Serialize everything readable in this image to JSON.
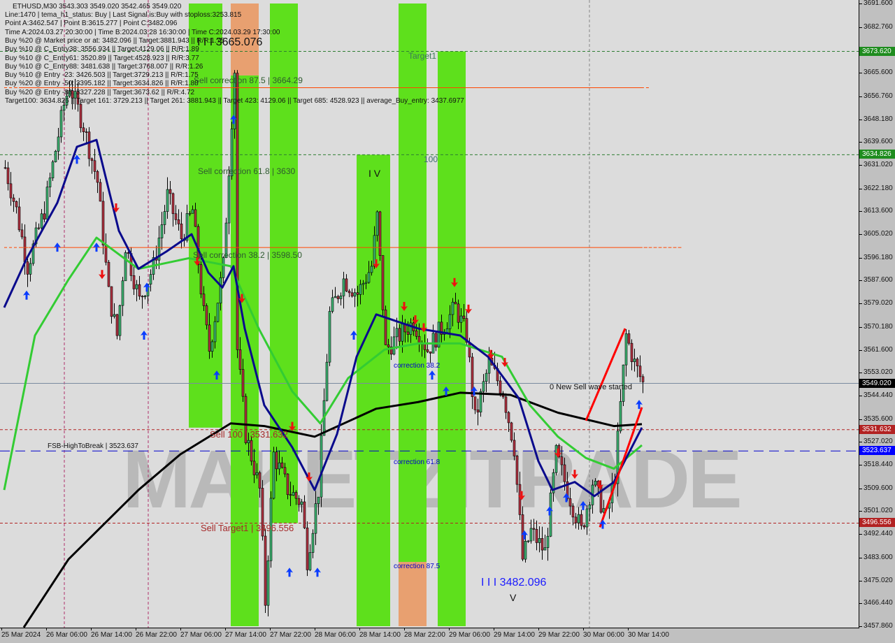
{
  "chart_data": {
    "type": "candlestick",
    "symbol_line": "ETHUSD,M30  3543.303 3549.020 3542.465 3549.020",
    "info_lines": [
      "Line:1470 | tema_h1_status: Buy | Last Signal is:Buy with stoploss:3253.815",
      "Point A:3462.547 | Point B:3615.277 | Point C:3482.096",
      "Time A:2024.03.27 20:30:00 | Time B:2024.03.28 16:30:00 | Time C:2024.03.29 17:30:00",
      "Buy %20 @ Market price or at: 3482.096 || Target:3881.943 || R/R:1.75",
      "Buy %10 @ C_Entry38: 3556.934 || Target:4129.06 || R/R:1.89",
      "Buy %10 @ C_Entry61: 3520.89 || Target:4528.923 || R/R:3.77",
      "Buy %10 @ C_Entry88: 3481.638 || Target:3768.007 || R/R:1.26",
      "Buy %10 @ Entry -23: 3426.503 || Target:3729.213 || R/R:1.75",
      "Buy %20 @ Entry -50: 3395.182 || Target:3634.826 || R/R:1.88",
      "Buy %20 @ Entry -88: 3327.228 || Target:3673.62 || R/R:4.72",
      "Target100: 3634.826 || Target 161: 3729.213 || Target 261: 3881.943 || Target 423: 4129.06 || Target 685: 4528.923 || average_Buy_entry: 3437.6977"
    ],
    "ylim": [
      3457.86,
      3691.6
    ],
    "y_ticks": [
      "3691.600",
      "3682.760",
      "3673.620",
      "3665.600",
      "3656.760",
      "3648.180",
      "3639.600",
      "3631.020",
      "3622.180",
      "3613.600",
      "3605.020",
      "3596.180",
      "3587.600",
      "3579.020",
      "3570.180",
      "3561.600",
      "3553.020",
      "3544.440",
      "3535.600",
      "3527.020",
      "3518.440",
      "3509.600",
      "3501.020",
      "3492.440",
      "3483.600",
      "3475.020",
      "3466.440",
      "3457.860"
    ],
    "x_ticks": [
      {
        "label": "25 Mar 2024",
        "t": "25 22:00"
      },
      {
        "label": "26 Mar 06:00",
        "t": "26 06:00"
      },
      {
        "label": "26 Mar 14:00",
        "t": "26 14:00"
      },
      {
        "label": "26 Mar 22:00",
        "t": "26 22:00"
      },
      {
        "label": "27 Mar 06:00",
        "t": "27 06:00"
      },
      {
        "label": "27 Mar 14:00",
        "t": "27 14:00"
      },
      {
        "label": "27 Mar 22:00",
        "t": "27 22:00"
      },
      {
        "label": "28 Mar 06:00",
        "t": "28 06:00"
      },
      {
        "label": "28 Mar 14:00",
        "t": "28 14:00"
      },
      {
        "label": "28 Mar 22:00",
        "t": "28 22:00"
      },
      {
        "label": "29 Mar 06:00",
        "t": "29 06:00"
      },
      {
        "label": "29 Mar 14:00",
        "t": "29 14:00"
      },
      {
        "label": "29 Mar 22:00",
        "t": "29 22:00"
      },
      {
        "label": "30 Mar 06:00",
        "t": "30 06:00"
      },
      {
        "label": "30 Mar 14:00",
        "t": "30 14:00"
      }
    ],
    "price_badges": [
      {
        "value": "3673.620",
        "price": 3673.62,
        "color": "#1e8c1e"
      },
      {
        "value": "3634.826",
        "price": 3634.826,
        "color": "#1e8c1e"
      },
      {
        "value": "3549.020",
        "price": 3549.02,
        "color": "#000000"
      },
      {
        "value": "3531.632",
        "price": 3531.632,
        "color": "#b22222"
      },
      {
        "value": "3523.637",
        "price": 3523.637,
        "color": "#0000ff"
      },
      {
        "value": "3496.556",
        "price": 3496.556,
        "color": "#b22222"
      }
    ],
    "hlines": [
      {
        "price": 3673.62,
        "color": "#2e7d32",
        "style": "dashed"
      },
      {
        "price": 3634.826,
        "color": "#2e7d32",
        "style": "dashed"
      },
      {
        "price": 3549.02,
        "color": "#7a8aa0",
        "style": "solid"
      },
      {
        "price": 3531.632,
        "color": "#b22222",
        "style": "dashed"
      },
      {
        "price": 3523.637,
        "color": "#0000cc",
        "style": "dashed"
      },
      {
        "price": 3496.556,
        "color": "#b22222",
        "style": "dashed"
      }
    ],
    "zones": [
      {
        "from": "27 07:30",
        "to": "27 13:30",
        "top": 3691.6,
        "bottom": 3532.4,
        "color": "#5ee01c"
      },
      {
        "from": "27 15:00",
        "to": "27 20:00",
        "top": 3664.6,
        "bottom": 3457.86,
        "color": "#5ee01c"
      },
      {
        "from": "27 15:00",
        "to": "27 20:00",
        "top": 3691.6,
        "bottom": 3664.6,
        "color": "#e8a070"
      },
      {
        "from": "27 22:00",
        "to": "28 03:00",
        "top": 3691.6,
        "bottom": 3496.556,
        "color": "#5ee01c"
      },
      {
        "from": "28 13:30",
        "to": "28 19:30",
        "top": 3634.826,
        "bottom": 3457.86,
        "color": "#5ee01c"
      },
      {
        "from": "28 21:00",
        "to": "29 02:00",
        "top": 3691.6,
        "bottom": 3482.0,
        "color": "#5ee01c"
      },
      {
        "from": "28 21:00",
        "to": "29 02:00",
        "top": 3482.0,
        "bottom": 3457.86,
        "color": "#e8a070"
      },
      {
        "from": "29 04:00",
        "to": "29 09:00",
        "top": 3673.62,
        "bottom": 3457.86,
        "color": "#5ee01c"
      }
    ],
    "price_path": [
      [
        "25 22:30",
        3630
      ],
      [
        "26 00:30",
        3614
      ],
      [
        "26 02:30",
        3593
      ],
      [
        "26 05:30",
        3614
      ],
      [
        "26 09:00",
        3653.5
      ],
      [
        "26 10:00",
        3661
      ],
      [
        "26 12:30",
        3645.7
      ],
      [
        "26 15:00",
        3624.7
      ],
      [
        "26 17:00",
        3582.7
      ],
      [
        "26 18:30",
        3567
      ],
      [
        "26 20:00",
        3601
      ],
      [
        "26 22:30",
        3580
      ],
      [
        "27 01:00",
        3593
      ],
      [
        "27 03:30",
        3619.5
      ],
      [
        "27 06:00",
        3603.7
      ],
      [
        "27 08:00",
        3614
      ],
      [
        "27 10:00",
        3574.9
      ],
      [
        "27 11:00",
        3561.7
      ],
      [
        "27 13:30",
        3593
      ],
      [
        "27 15:30",
        3666.7
      ],
      [
        "27 16:00",
        3561.7
      ],
      [
        "27 17:30",
        3530
      ],
      [
        "27 20:00",
        3509
      ],
      [
        "27 21:00",
        3467
      ],
      [
        "27 22:30",
        3522.4
      ],
      [
        "28 01:00",
        3509.3
      ],
      [
        "28 03:30",
        3504
      ],
      [
        "28 04:30",
        3483
      ],
      [
        "28 06:30",
        3509
      ],
      [
        "28 08:30",
        3575
      ],
      [
        "28 11:00",
        3588
      ],
      [
        "28 13:30",
        3582.7
      ],
      [
        "28 16:00",
        3593
      ],
      [
        "28 17:00",
        3611.6
      ],
      [
        "28 18:30",
        3561.7
      ],
      [
        "28 21:00",
        3567
      ],
      [
        "28 23:30",
        3572
      ],
      [
        "29 02:00",
        3561.7
      ],
      [
        "29 04:30",
        3569.6
      ],
      [
        "29 07:00",
        3577.5
      ],
      [
        "29 09:00",
        3567
      ],
      [
        "29 10:30",
        3535.5
      ],
      [
        "29 13:00",
        3556.5
      ],
      [
        "29 15:30",
        3546
      ],
      [
        "29 17:30",
        3525
      ],
      [
        "29 19:00",
        3483
      ],
      [
        "29 20:30",
        3493.5
      ],
      [
        "29 23:00",
        3485.7
      ],
      [
        "30 01:00",
        3522.4
      ],
      [
        "30 03:00",
        3509
      ],
      [
        "30 05:30",
        3493.5
      ],
      [
        "30 07:30",
        3512
      ],
      [
        "30 10:00",
        3498.8
      ],
      [
        "30 11:30",
        3514.6
      ],
      [
        "30 13:30",
        3567
      ],
      [
        "30 15:00",
        3556.5
      ],
      [
        "30 16:30",
        3549.02
      ]
    ],
    "series": [
      {
        "color": "#000000",
        "points": [
          [
            "26 02:00",
            3457.4
          ],
          [
            "26 10:00",
            3483
          ],
          [
            "26 22:30",
            3509
          ],
          [
            "27 06:00",
            3522.4
          ],
          [
            "27 15:00",
            3534
          ],
          [
            "27 21:00",
            3533
          ],
          [
            "28 06:00",
            3529
          ],
          [
            "28 17:00",
            3539.5
          ],
          [
            "29 00:30",
            3542
          ],
          [
            "29 08:00",
            3545.5
          ],
          [
            "29 17:00",
            3544.7
          ],
          [
            "30 01:30",
            3538
          ],
          [
            "30 11:30",
            3533
          ],
          [
            "30 16:30",
            3533.7
          ]
        ]
      },
      {
        "color": "#33cc33",
        "points": [
          [
            "25 22:30",
            3509
          ],
          [
            "26 04:00",
            3567
          ],
          [
            "26 10:00",
            3588
          ],
          [
            "26 15:00",
            3603.7
          ],
          [
            "26 22:30",
            3592
          ],
          [
            "27 07:30",
            3596
          ],
          [
            "27 15:00",
            3593
          ],
          [
            "27 20:00",
            3569.6
          ],
          [
            "28 02:00",
            3546
          ],
          [
            "28 07:00",
            3534
          ],
          [
            "28 12:00",
            3551
          ],
          [
            "28 18:30",
            3561.7
          ],
          [
            "29 00:30",
            3564
          ],
          [
            "29 08:00",
            3564
          ],
          [
            "29 15:30",
            3559
          ],
          [
            "29 20:30",
            3540.8
          ],
          [
            "30 01:30",
            3529
          ],
          [
            "30 06:30",
            3521
          ],
          [
            "30 11:30",
            3517
          ],
          [
            "30 16:30",
            3525.8
          ]
        ]
      },
      {
        "color": "#0a0a8c",
        "points": [
          [
            "25 22:30",
            3577.5
          ],
          [
            "26 02:30",
            3595.8
          ],
          [
            "26 08:00",
            3616.8
          ],
          [
            "26 11:30",
            3637.8
          ],
          [
            "26 15:00",
            3640.4
          ],
          [
            "26 19:00",
            3606.3
          ],
          [
            "26 22:30",
            3592
          ],
          [
            "27 03:30",
            3598.5
          ],
          [
            "27 08:00",
            3605
          ],
          [
            "27 11:00",
            3590.6
          ],
          [
            "27 13:30",
            3585
          ],
          [
            "27 15:30",
            3593
          ],
          [
            "27 17:30",
            3569.6
          ],
          [
            "27 21:00",
            3540.8
          ],
          [
            "28 02:00",
            3525
          ],
          [
            "28 06:00",
            3509
          ],
          [
            "28 10:00",
            3530
          ],
          [
            "28 13:30",
            3559
          ],
          [
            "28 17:00",
            3574.9
          ],
          [
            "29 00:30",
            3569.6
          ],
          [
            "29 08:00",
            3567
          ],
          [
            "29 13:00",
            3559
          ],
          [
            "29 18:30",
            3543.4
          ],
          [
            "29 22:00",
            3519.8
          ],
          [
            "30 00:30",
            3509
          ],
          [
            "30 04:30",
            3512
          ],
          [
            "30 08:00",
            3506.7
          ],
          [
            "30 11:30",
            3512
          ],
          [
            "30 16:30",
            3532.4
          ]
        ]
      }
    ],
    "trend_lines": [
      {
        "color": "#ff0000",
        "from": [
          "30 06:30",
          3535
        ],
        "to": [
          "30 13:30",
          3569.6
        ]
      },
      {
        "color": "#ff0000",
        "from": [
          "30 09:00",
          3495
        ],
        "to": [
          "30 16:30",
          3540
        ]
      }
    ],
    "buy_arrows": [
      [
        "26 02:30",
        3582
      ],
      [
        "26 08:00",
        3600
      ],
      [
        "26 11:30",
        3633
      ],
      [
        "26 15:00",
        3600
      ],
      [
        "26 23:30",
        3567
      ],
      [
        "27 00:00",
        3585
      ],
      [
        "27 15:30",
        3648
      ],
      [
        "27 12:30",
        3552
      ],
      [
        "28 01:30",
        3478
      ],
      [
        "28 06:30",
        3478
      ],
      [
        "28 13:00",
        3567
      ],
      [
        "29 03:00",
        3552
      ],
      [
        "29 05:30",
        3546
      ],
      [
        "29 10:30",
        3546
      ],
      [
        "29 19:30",
        3492
      ],
      [
        "30 00:00",
        3501
      ],
      [
        "30 03:00",
        3506
      ],
      [
        "30 06:00",
        3503
      ],
      [
        "30 09:30",
        3496
      ],
      [
        "30 16:00",
        3541
      ]
    ],
    "sell_arrows": [
      [
        "26 16:00",
        3590
      ],
      [
        "26 18:30",
        3615
      ],
      [
        "27 09:00",
        3595
      ],
      [
        "27 17:00",
        3581
      ],
      [
        "28 02:00",
        3533
      ],
      [
        "28 05:00",
        3514
      ],
      [
        "28 17:00",
        3594
      ],
      [
        "28 22:00",
        3578
      ],
      [
        "29 00:00",
        3573
      ],
      [
        "29 01:30",
        3570
      ],
      [
        "29 07:00",
        3587
      ],
      [
        "29 09:30",
        3577
      ],
      [
        "29 13:30",
        3560
      ],
      [
        "29 16:00",
        3557
      ],
      [
        "29 19:00",
        3507
      ],
      [
        "30 01:30",
        3523
      ],
      [
        "30 04:30",
        3515
      ],
      [
        "30 09:00",
        3511
      ]
    ],
    "annotations": {
      "wave3_top": "I I I 3665.076",
      "sell_corr_875": "Sell correction 87.5 | 3664.29",
      "sell_corr_618": "Sell correction 61.8 | 3630",
      "sell_corr_382": "Sell correction 38.2 | 3598.50",
      "sell_100": "Sell 100 | 3531.632",
      "sell_target1": "Sell Target1 | 3496.556",
      "fsb": "FSB-HighToBreak | 3523.637",
      "target1": "Target1",
      "t100": "100",
      "wave4": "I V",
      "corr_382": "correction 38.2",
      "corr_618": "correction 61.8",
      "corr_875": "correction 87.5",
      "wave3_bottom": "I I I 3482.096",
      "wave5": "V",
      "new_wave": "0 New Sell wave started"
    },
    "watermark": "MARKETZITRADE"
  }
}
